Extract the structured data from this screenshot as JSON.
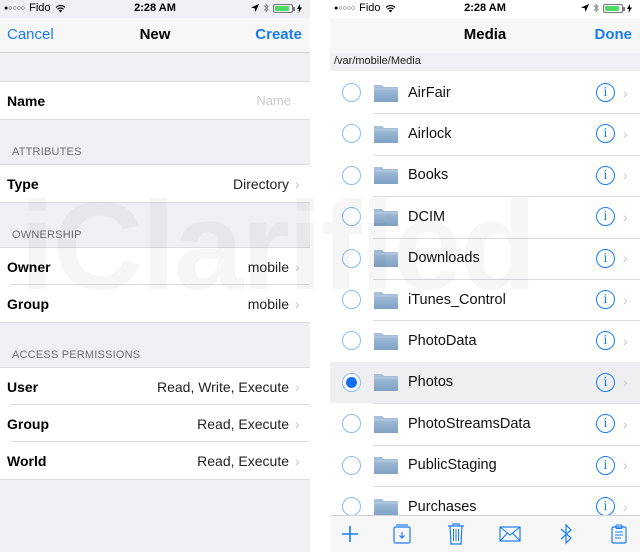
{
  "status_bar": {
    "carrier": "Fido",
    "signal_dots": "●○○○○",
    "time": "2:28 AM"
  },
  "left": {
    "nav": {
      "cancel": "Cancel",
      "title": "New",
      "create": "Create"
    },
    "name_row": {
      "label": "Name",
      "placeholder": "Name"
    },
    "sections": {
      "attributes": "ATTRIBUTES",
      "ownership": "OWNERSHIP",
      "access": "ACCESS PERMISSIONS"
    },
    "type_row": {
      "label": "Type",
      "value": "Directory"
    },
    "owner_row": {
      "label": "Owner",
      "value": "mobile"
    },
    "group_row": {
      "label": "Group",
      "value": "mobile"
    },
    "user_perm": {
      "label": "User",
      "value": "Read, Write, Execute"
    },
    "group_perm": {
      "label": "Group",
      "value": "Read, Execute"
    },
    "world_perm": {
      "label": "World",
      "value": "Read, Execute"
    }
  },
  "right": {
    "nav": {
      "title": "Media",
      "done": "Done"
    },
    "path": "/var/mobile/Media",
    "folders": [
      {
        "name": "AirFair",
        "selected": false
      },
      {
        "name": "Airlock",
        "selected": false
      },
      {
        "name": "Books",
        "selected": false
      },
      {
        "name": "DCIM",
        "selected": false
      },
      {
        "name": "Downloads",
        "selected": false
      },
      {
        "name": "iTunes_Control",
        "selected": false
      },
      {
        "name": "PhotoData",
        "selected": false
      },
      {
        "name": "Photos",
        "selected": true
      },
      {
        "name": "PhotoStreamsData",
        "selected": false
      },
      {
        "name": "PublicStaging",
        "selected": false
      },
      {
        "name": "Purchases",
        "selected": false
      }
    ],
    "toolbar": [
      "add-icon",
      "archive-icon",
      "trash-icon",
      "mail-icon",
      "bluetooth-icon",
      "clipboard-icon"
    ]
  },
  "watermark": "iClarified",
  "colors": {
    "accent": "#1a7cf5",
    "group_bg": "#efeff4",
    "battery": "#4cd964"
  }
}
